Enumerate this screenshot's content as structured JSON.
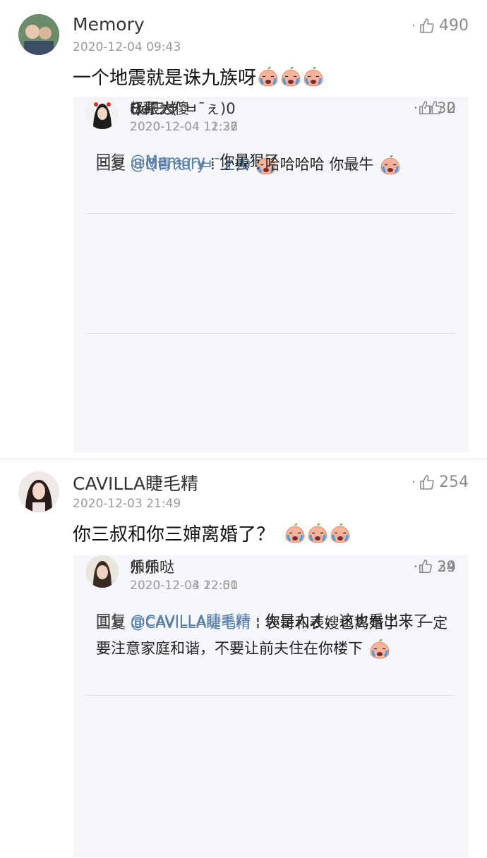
{
  "comments": [
    {
      "user": "Memory",
      "time": "2020-12-04 09:43",
      "likes": "490",
      "text": "一个地震就是诛九族呀",
      "emoji_count": 3,
      "replies": [
        {
          "user": "Q青ぇ(¯ㅂ¯ぇ)0",
          "time": "2020-12-04 11:27",
          "likes": "30",
          "prefix": "回复",
          "mention": "@Memory",
          "colon": " : ",
          "text": "你最狠了"
        },
        {
          "user": "极限大傻",
          "time": "2020-12-04 12:32",
          "likes": "2",
          "prefix": "回复",
          "mention": "@Memory",
          "colon": " : ",
          "text": "上去"
        },
        {
          "user": "He三岁",
          "time": "2020-12-04 11:36",
          "likes": "",
          "prefix": "回复",
          "mention": "@Q青ぇ(¯ㅂ¯ぇ)0",
          "colon": " : ",
          "text": "哈哈哈哈 你最牛"
        }
      ]
    },
    {
      "user": "CAVILLA睫毛精",
      "time": "2020-12-03 21:49",
      "likes": "254",
      "text": "你三叔和你三婶离婚了？",
      "emoji_count": 3,
      "replies": [
        {
          "user": "帅帅哒",
          "time": "2020-12-03 22:51",
          "likes": "39",
          "prefix": "回复",
          "mention": "@CAVILLA睫毛精",
          "colon": " : ",
          "text": "你是人才，这也看出来了"
        },
        {
          "user": "乐乐",
          "time": "2020-12-04 12:00",
          "likes": "24",
          "prefix": "回复",
          "mention": "@CAVILLA睫毛精",
          "colon": " : ",
          "text": "表哥和表嫂也离婚了 ，一定要注意家庭和谐，不要让前夫住在你楼下"
        }
      ]
    }
  ],
  "icons": {
    "like": "thumbs-up-icon",
    "emoji": "crying-face-emoji-icon"
  },
  "colors": {
    "mention": "#5a7fa8",
    "reply_bg": "#f4f6f9",
    "meta": "#9a9a9a"
  }
}
